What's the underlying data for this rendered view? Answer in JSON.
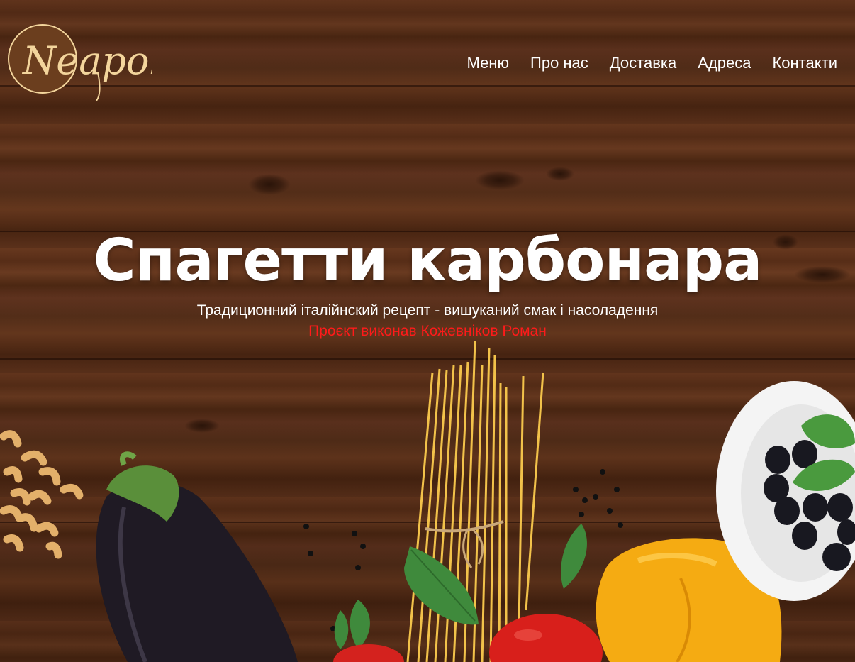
{
  "brand": {
    "logo_text": "Neapol",
    "colors": {
      "logo_circle": "#6b3e1e",
      "logo_script": "#f3d59c"
    }
  },
  "nav": {
    "items": [
      {
        "label": "Меню"
      },
      {
        "label": "Про нас"
      },
      {
        "label": "Доставка"
      },
      {
        "label": "Адреса"
      },
      {
        "label": "Контакти"
      }
    ]
  },
  "hero": {
    "title": "Спагетти карбонара",
    "subtitle": "Традиционний італійнский рецепт - вишуканий смак і насоладення",
    "credit": "Проєкт виконав Кожевніков Роман",
    "colors": {
      "title": "#ffffff",
      "credit": "#ff1a1a",
      "wood": "#5a2f18"
    },
    "decor": [
      "macaroni",
      "eggplant",
      "spaghetti-bundle",
      "basil-leaf",
      "tomato",
      "yellow-pepper",
      "olives-bowl",
      "peppercorns"
    ]
  }
}
